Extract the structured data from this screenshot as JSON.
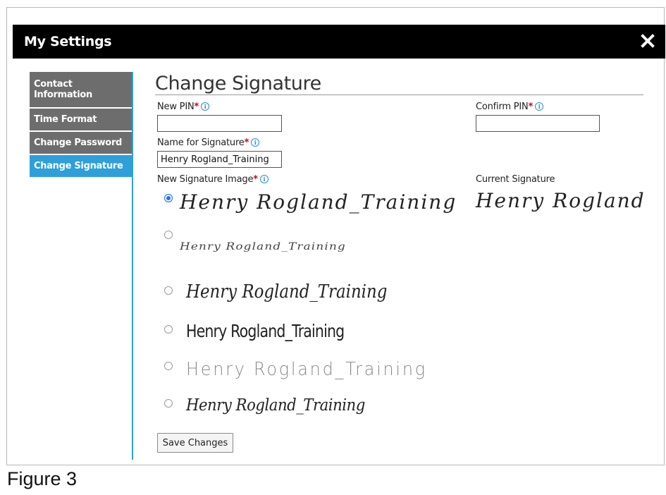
{
  "dialog": {
    "title": "My Settings",
    "close_icon": "close-icon"
  },
  "sidebar": {
    "items": [
      {
        "label": "Contact Information",
        "active": false
      },
      {
        "label": "Time Format",
        "active": false
      },
      {
        "label": "Change Password",
        "active": false
      },
      {
        "label": "Change Signature",
        "active": true
      }
    ]
  },
  "main": {
    "title": "Change Signature",
    "new_pin": {
      "label": "New PIN",
      "required": "*",
      "value": ""
    },
    "confirm_pin": {
      "label": "Confirm PIN",
      "required": "*",
      "value": ""
    },
    "name_for_signature": {
      "label": "Name for Signature",
      "required": "*",
      "value": "Henry Rogland_Training"
    },
    "new_signature_image": {
      "label": "New Signature Image",
      "required": "*",
      "options": [
        {
          "text": "Henry Rogland_Training",
          "selected": true
        },
        {
          "text": "Henry Rogland_Training",
          "selected": false
        },
        {
          "text": "Henry Rogland_Training",
          "selected": false
        },
        {
          "text": "Henry Rogland_Training",
          "selected": false
        },
        {
          "text": "Henry Rogland_Training",
          "selected": false
        },
        {
          "text": "Henry Rogland_Training",
          "selected": false
        }
      ]
    },
    "current_signature": {
      "label": "Current Signature",
      "text": "Henry Rogland"
    },
    "save_label": "Save Changes"
  },
  "caption": "Figure 3",
  "colors": {
    "header_bg": "#000000",
    "sidebar_bg": "#6d6d6d",
    "accent": "#2e9fd9",
    "required": "#d0021b"
  },
  "icons": {
    "info": "info-icon",
    "close": "close-icon"
  }
}
